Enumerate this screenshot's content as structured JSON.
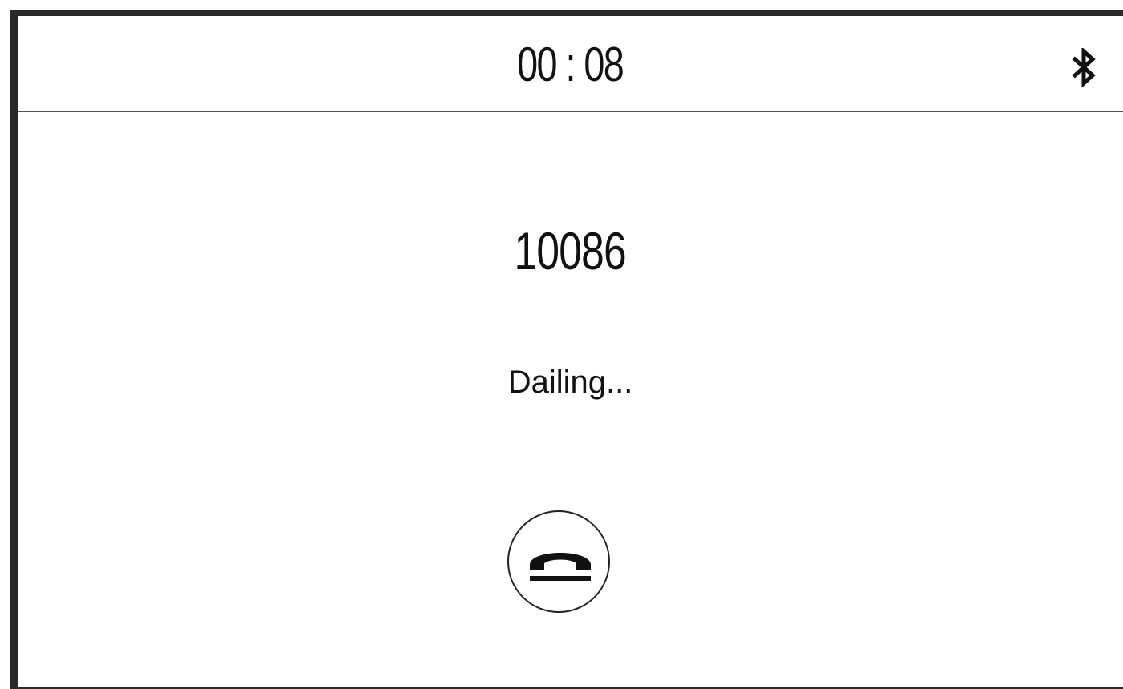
{
  "status_bar": {
    "timer": "00 : 08",
    "bluetooth_icon": "bluetooth-icon"
  },
  "call": {
    "number": "10086",
    "status": "Dailing...",
    "hangup_icon": "hangup-phone-icon"
  },
  "colors": {
    "foreground": "#111111",
    "background": "#ffffff",
    "divider": "#555555"
  }
}
